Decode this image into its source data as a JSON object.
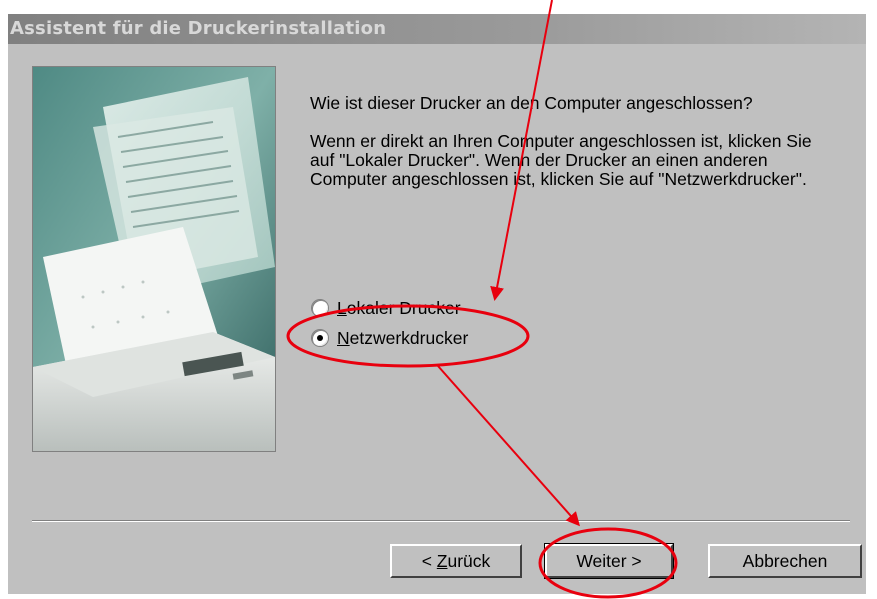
{
  "window": {
    "title": "Assistent für die Druckerinstallation"
  },
  "content": {
    "question": "Wie ist dieser Drucker an den Computer angeschlossen?",
    "explanation": "Wenn er direkt an Ihren Computer angeschlossen ist, klicken Sie auf \"Lokaler Drucker\". Wenn der Drucker an einen anderen Computer angeschlossen ist, klicken Sie auf \"Netzwerkdrucker\"."
  },
  "options": {
    "local": {
      "accel": "L",
      "rest": "okaler Drucker",
      "checked": false
    },
    "network": {
      "accel": "N",
      "rest": "etzwerkdrucker",
      "checked": true
    }
  },
  "buttons": {
    "back": {
      "pre": "< ",
      "accel": "Z",
      "rest": "urück"
    },
    "next": "Weiter >",
    "cancel": "Abbrechen"
  },
  "colors": {
    "dialog_bg": "#c0c0c0",
    "titlebar_inactive": "#808080",
    "annotation": "#e8000e"
  },
  "illustration": {
    "icon": "printer-with-paper-image"
  },
  "annotations": {
    "type": "red-arrows-and-circles"
  }
}
